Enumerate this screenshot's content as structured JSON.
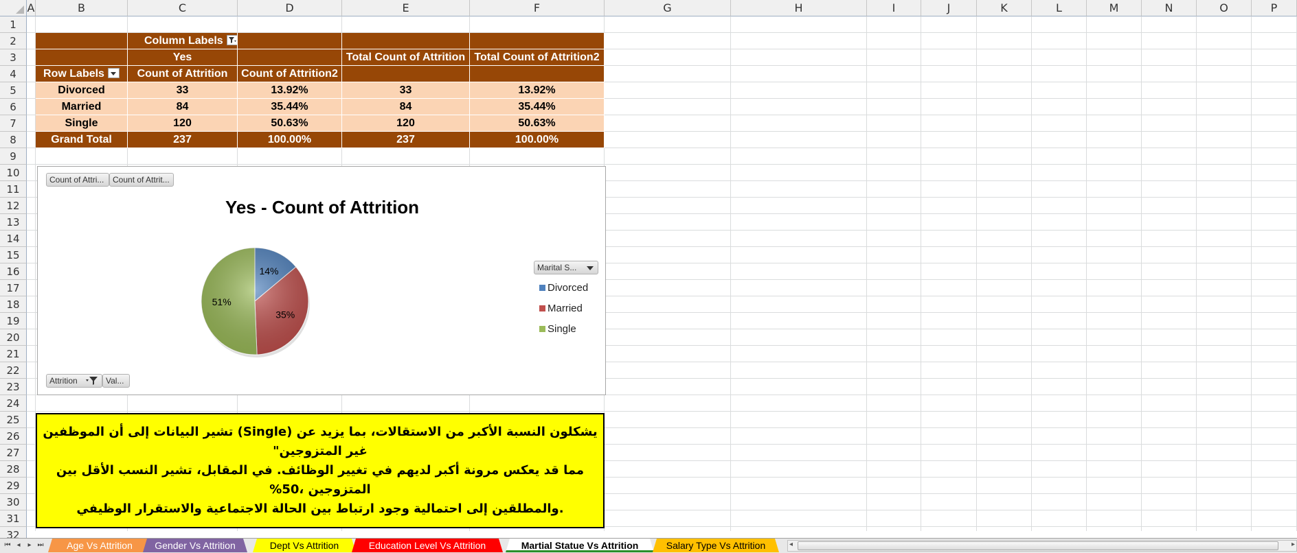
{
  "columns": [
    "A",
    "B",
    "C",
    "D",
    "E",
    "F",
    "G",
    "H",
    "I",
    "J",
    "K",
    "L",
    "M",
    "N",
    "O",
    "P"
  ],
  "rows": [
    "1",
    "2",
    "3",
    "4",
    "5",
    "6",
    "7",
    "8",
    "9",
    "10",
    "11",
    "12",
    "13",
    "14",
    "15",
    "16",
    "17",
    "18",
    "19",
    "20",
    "21",
    "22",
    "23",
    "24",
    "25",
    "26",
    "27",
    "28",
    "29",
    "30",
    "31",
    "32"
  ],
  "pivot": {
    "column_labels": "Column Labels",
    "yes": "Yes",
    "total_count": "Total Count of Attrition",
    "total_count2": "Total Count of Attrition2",
    "row_labels": "Row Labels",
    "count_of_attrition": "Count of Attrition",
    "count_of_attrition2": "Count of Attrition2",
    "data": [
      {
        "label": "Divorced",
        "count": "33",
        "pct": "13.92%",
        "total": "33",
        "total_pct": "13.92%"
      },
      {
        "label": "Married",
        "count": "84",
        "pct": "35.44%",
        "total": "84",
        "total_pct": "35.44%"
      },
      {
        "label": "Single",
        "count": "120",
        "pct": "50.63%",
        "total": "120",
        "total_pct": "50.63%"
      }
    ],
    "grand_total": {
      "label": "Grand Total",
      "count": "237",
      "pct": "100.00%",
      "total": "237",
      "total_pct": "100.00%"
    }
  },
  "chart": {
    "field_btn_1": "Count of Attri...",
    "field_btn_2": "Count of Attrit...",
    "axis_btn": "Attrition",
    "values_btn": "Val...",
    "legend_btn": "Marital S...",
    "colors": {
      "Divorced": "#4f81bd",
      "Married": "#c0504d",
      "Single": "#9bbb59"
    }
  },
  "chart_data": {
    "type": "pie",
    "title": "Yes - Count of Attrition",
    "categories": [
      "Divorced",
      "Married",
      "Single"
    ],
    "values": [
      33,
      84,
      120
    ],
    "data_labels": [
      "14%",
      "35%",
      "51%"
    ],
    "legend": "right"
  },
  "note": {
    "line1": "يشكلون النسبة الأكبر من الاستقالات، بما يزيد عن (Single) تشير البيانات إلى أن الموظفين غير المتزوجين\"",
    "line2": "مما قد يعكس مرونة أكبر لديهم في تغيير الوظائف. في المقابل، تشير النسب الأقل بين المتزوجين ،50%",
    "line3": ".والمطلقين إلى احتمالية وجود ارتباط بين الحالة الاجتماعية والاستقرار الوظيفي"
  },
  "sheet_tabs": [
    {
      "label": "Age Vs Attrition",
      "color": "#f79646",
      "text": "#fff",
      "active": false
    },
    {
      "label": "Gender Vs Attrition",
      "color": "#8064a2",
      "text": "#fff",
      "active": false
    },
    {
      "label": "Dept Vs Attrition",
      "color": "#ffff00",
      "text": "#000",
      "active": false
    },
    {
      "label": "Education Level Vs Attrition",
      "color": "#ff0000",
      "text": "#fff",
      "active": false
    },
    {
      "label": "Martial Statue Vs Attrition",
      "color": "#ffffff",
      "text": "#000",
      "active": true
    },
    {
      "label": "Salary Type  Vs Attrition",
      "color": "#ffc000",
      "text": "#000",
      "active": false
    }
  ]
}
